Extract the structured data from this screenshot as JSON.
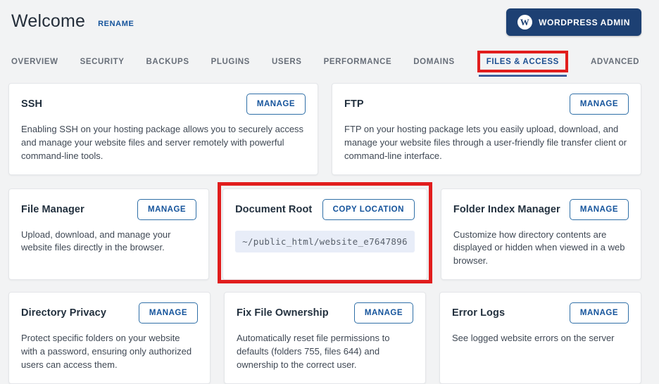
{
  "header": {
    "title": "Welcome",
    "rename_label": "RENAME",
    "wordpress_admin_label": "WORDPRESS ADMIN",
    "wordpress_logo_glyph": "W"
  },
  "tabs": [
    {
      "label": "OVERVIEW",
      "active": false
    },
    {
      "label": "SECURITY",
      "active": false
    },
    {
      "label": "BACKUPS",
      "active": false
    },
    {
      "label": "PLUGINS",
      "active": false
    },
    {
      "label": "USERS",
      "active": false
    },
    {
      "label": "PERFORMANCE",
      "active": false
    },
    {
      "label": "DOMAINS",
      "active": false
    },
    {
      "label": "FILES & ACCESS",
      "active": true
    },
    {
      "label": "ADVANCED",
      "active": false
    }
  ],
  "cards": [
    {
      "title": "SSH",
      "button": "MANAGE",
      "description": "Enabling SSH on your hosting package allows you to securely access and manage your website files and server remotely with powerful command-line tools."
    },
    {
      "title": "FTP",
      "button": "MANAGE",
      "description": "FTP on your hosting package lets you easily upload, download, and manage your website files through a user-friendly file transfer client or command-line interface."
    },
    {
      "title": "File Manager",
      "button": "MANAGE",
      "description": "Upload, download, and manage your website files directly in the browser."
    },
    {
      "title": "Document Root",
      "button": "COPY LOCATION",
      "path": "~/public_html/website_e7647896",
      "annotated": true
    },
    {
      "title": "Folder Index Manager",
      "button": "MANAGE",
      "description": "Customize how directory contents are displayed or hidden when viewed in a web browser."
    },
    {
      "title": "Directory Privacy",
      "button": "MANAGE",
      "description": "Protect specific folders on your website with a password, ensuring only authorized users can access them."
    },
    {
      "title": "Fix File Ownership",
      "button": "MANAGE",
      "description": "Automatically reset file permissions to defaults (folders 755, files 644) and ownership to the correct user."
    },
    {
      "title": "Error Logs",
      "button": "MANAGE",
      "description": "See logged website errors on the server"
    }
  ],
  "colors": {
    "page_background": "#f2f3f4",
    "navy_button": "#1d4073",
    "link_blue": "#14539b",
    "active_tab": "#1d4f91",
    "tab_underline": "#2b4d8e",
    "annotation_red": "#e11d1d",
    "path_background": "#e8edf8"
  }
}
